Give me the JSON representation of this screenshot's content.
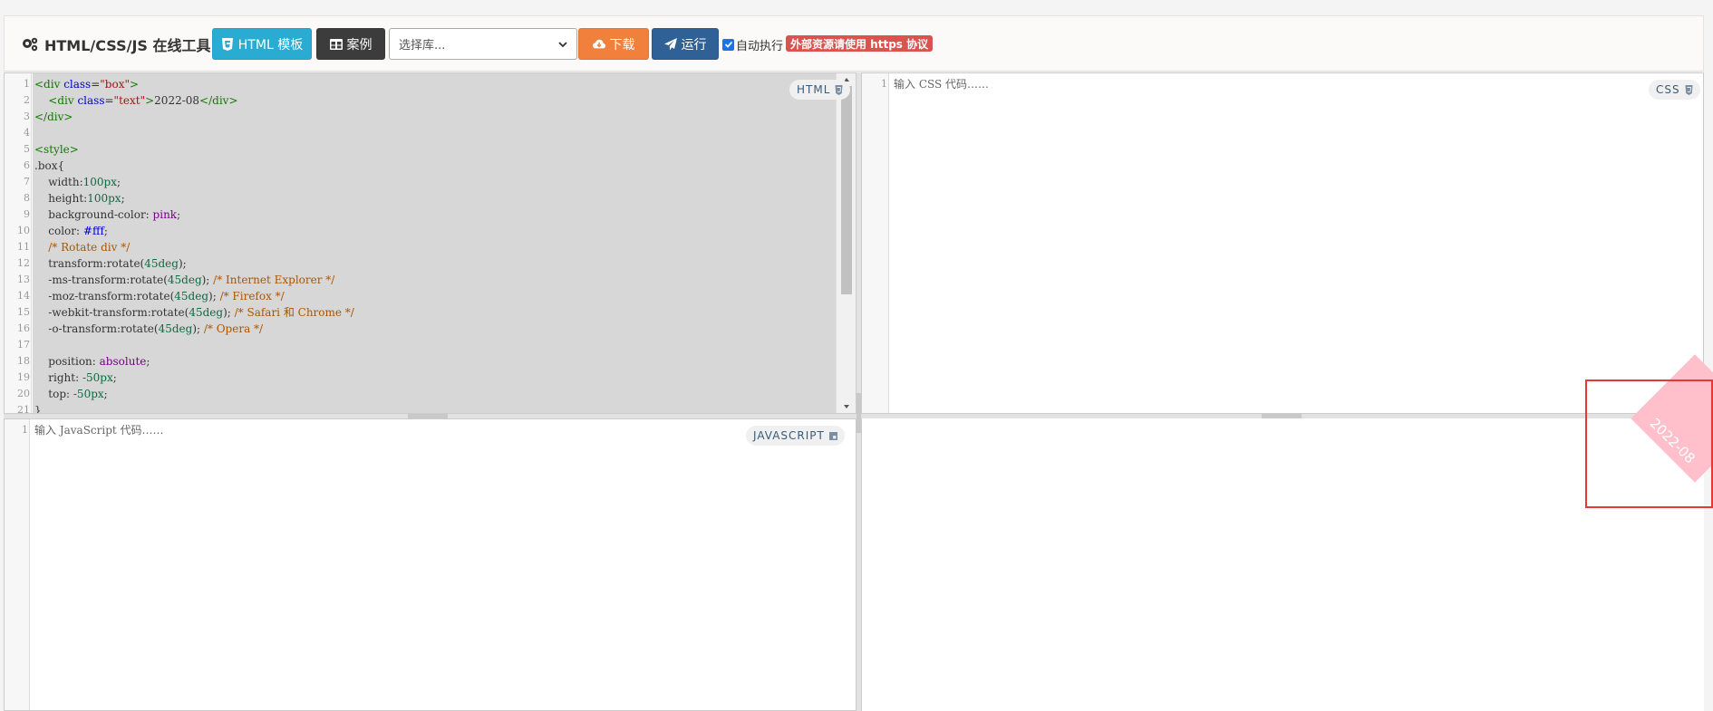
{
  "toolbar": {
    "brand": "HTML/CSS/JS 在线工具",
    "template_label": "HTML 模板",
    "examples_label": "案例",
    "library_select": {
      "value": "选择库..."
    },
    "download_label": "下载",
    "run_label": "运行",
    "auto_run_label": "自动执行",
    "auto_run_checked": true,
    "warning_badge": "外部资源请使用 https 协议"
  },
  "html_editor": {
    "tag": "HTML",
    "line_numbers": [
      "1",
      "2",
      "3",
      "4",
      "5",
      "6",
      "7",
      "8",
      "9",
      "10",
      "11",
      "12",
      "13",
      "14",
      "15",
      "16",
      "17",
      "18",
      "19",
      "20",
      "21"
    ]
  },
  "css_editor": {
    "tag": "CSS",
    "line_numbers": [
      "1"
    ],
    "placeholder": "输入 CSS 代码……"
  },
  "js_editor": {
    "tag": "JAVASCRIPT",
    "line_numbers": [
      "1"
    ],
    "placeholder": "输入 JavaScript 代码……"
  },
  "preview": {
    "text": "2022-08"
  },
  "colors": {
    "template_button": "#2aabd2",
    "examples_button": "#3c3c3c",
    "download_button": "#f0803c",
    "run_button": "#2f6096",
    "warning_badge": "#d9534f",
    "preview_box": "pink",
    "highlight": "#e53935"
  }
}
